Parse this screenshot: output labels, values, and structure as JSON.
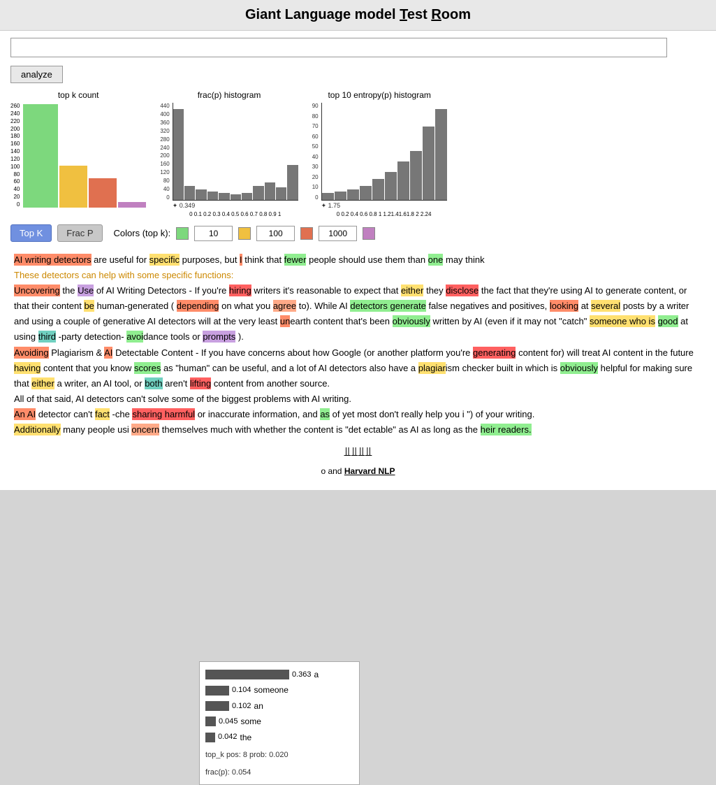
{
  "title": {
    "part1": "Giant Language model ",
    "part2": "T",
    "part3": "est ",
    "part4": "R",
    "part5": "oom"
  },
  "toolbar": {
    "analyze_label": "analyze",
    "topk_label": "Top K",
    "fracp_label": "Frac P",
    "colors_label": "Colors (top k):",
    "color_10": "10",
    "color_100": "100",
    "color_1000": "1000"
  },
  "charts": {
    "topk_title": "top k count",
    "fracp_title": "frac(p) histogram",
    "entropy_title": "top 10 entropy(p) histogram",
    "fracp_median": "✦ 0.349",
    "entropy_median": "✦ 1.75",
    "fracp_xaxis": "0  0.1 0.2 0.3 0.4 0.5 0.6 0.7 0.8 0.9  1",
    "entropy_xaxis": "0 0.2 0.4 0.6 0.8 1 1.21.41.61.8 2 2.24",
    "topk_yaxis": [
      "260",
      "240",
      "220",
      "200",
      "180",
      "160",
      "140",
      "120",
      "100",
      "80",
      "60",
      "40",
      "20",
      "0"
    ],
    "fracp_yaxis": [
      "440",
      "400",
      "360",
      "320",
      "280",
      "240",
      "200",
      "160",
      "120",
      "80",
      "40",
      "0"
    ],
    "entropy_yaxis": [
      "90",
      "80",
      "70",
      "60",
      "50",
      "40",
      "30",
      "20",
      "10",
      "0"
    ]
  },
  "tooltip": {
    "prob1": "0.363",
    "word1": "a",
    "bar1_w": 120,
    "prob2": "0.104",
    "word2": "someone",
    "bar2_w": 34,
    "prob3": "0.102",
    "word3": "an",
    "bar3_w": 34,
    "prob4": "0.045",
    "word4": "some",
    "bar4_w": 15,
    "prob5": "0.042",
    "word5": "the",
    "bar5_w": 14,
    "footer1": "top_k pos: 8 prob: 0.020",
    "footer2": "frac(p): 0.054"
  },
  "footer": {
    "text1": "o and ",
    "text2": "Harvard NLP"
  },
  "text_content": {
    "p1": "AI writing detectors are useful for specific purposes, but I think that fewer people should use them than one may think.",
    "p2": "These detectors can help with some specific functions:",
    "p3_full": "Uncovering the Use of AI Writing Detectors - If you're hiring writers it's reasonable to expect that either they disclose the fact that they're using AI to generate content, or that their content be human-generated (depending on what you agree to). While AI detectors generate false negatives and positives, looking at several posts by a writer and using a couple of generative AI detectors will at the very least unearth content that's been obviously written by AI (even if it may not \"catch\" someone who is good at using third-party detection-avoidance tools or prompts).",
    "p4_full": "Avoiding Plagiarism & AI Detectable Content - If you have concerns about how Google (or another platform you're generating content for) will treat AI content in the future having content that you know scores as \"human\" can be useful, and a lot of AI detectors also have a plagiarism checker built in which is obviously helpful for making sure that either a writer, an AI tool, or both aren't lifting content from another source.",
    "p5": "All of that said, AI detectors can't solve some of the biggest problems with AI writing.",
    "p6_part1": "An AI detector can't fact-che",
    "p6_middle": "sharing harmful",
    "p6_part2": " or inaccurate information, and as of yet most don't really help you i",
    "p6_end": "s\") of your writing.",
    "p7_part1": "Additionally many people usi",
    "p7_middle": "oncern",
    "p7_part2": " themselves much with whether the content is \"det ectable\" as AI as long as the",
    "p7_end": "heir readers."
  }
}
